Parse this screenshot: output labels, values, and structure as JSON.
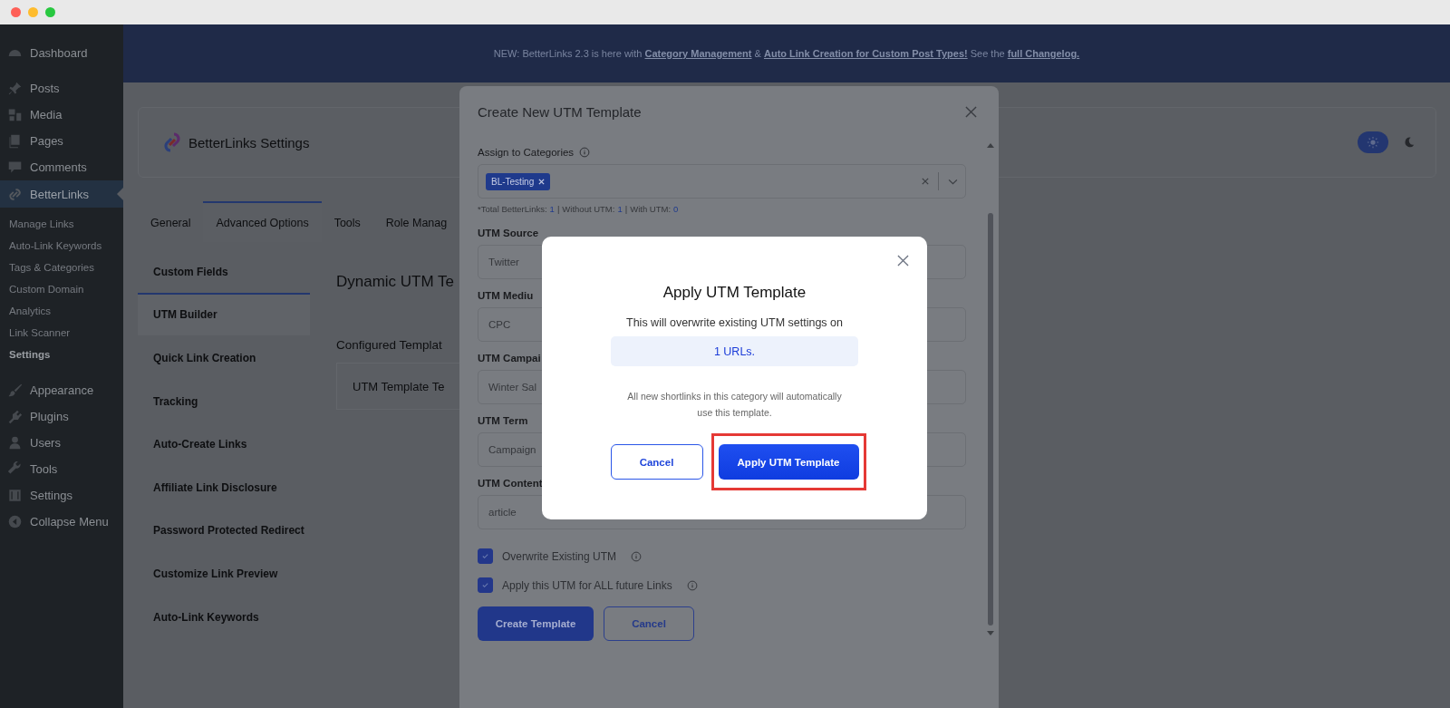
{
  "admin_menu": {
    "items": [
      {
        "label": "Dashboard",
        "selected": false
      },
      {
        "label": "Posts",
        "selected": false
      },
      {
        "label": "Media",
        "selected": false
      },
      {
        "label": "Pages",
        "selected": false
      },
      {
        "label": "Comments",
        "selected": false
      },
      {
        "label": "BetterLinks",
        "selected": true,
        "children": [
          {
            "label": "Manage Links",
            "selected": false
          },
          {
            "label": "Auto-Link Keywords",
            "selected": false
          },
          {
            "label": "Tags & Categories",
            "selected": false
          },
          {
            "label": "Custom Domain",
            "selected": false
          },
          {
            "label": "Analytics",
            "selected": false
          },
          {
            "label": "Link Scanner",
            "selected": false
          },
          {
            "label": "Settings",
            "selected": true
          }
        ]
      },
      {
        "label": "Appearance",
        "selected": false
      },
      {
        "label": "Plugins",
        "selected": false
      },
      {
        "label": "Users",
        "selected": false
      },
      {
        "label": "Tools",
        "selected": false
      },
      {
        "label": "Settings",
        "selected": false
      },
      {
        "label": "Collapse Menu",
        "selected": false
      }
    ]
  },
  "banner": {
    "parts": [
      {
        "text": "NEW: BetterLinks 2.3 is here with ",
        "link": false
      },
      {
        "text": "Category Management",
        "link": true
      },
      {
        "text": " & ",
        "link": false
      },
      {
        "text": "Auto Link Creation for Custom Post Types!",
        "link": true
      },
      {
        "text": " See the ",
        "link": false
      },
      {
        "text": "full Changelog.",
        "link": true
      }
    ]
  },
  "settings_header": {
    "title": "BetterLinks Settings",
    "theme_modes": [
      {
        "selected": true
      },
      {
        "selected": false
      }
    ]
  },
  "tabs": [
    {
      "label": "General",
      "selected": false
    },
    {
      "label": "Advanced Options",
      "selected": true
    },
    {
      "label": "Tools",
      "selected": false
    },
    {
      "label": "Role Manag",
      "selected": false
    }
  ],
  "settings_nav": [
    {
      "label": "Custom Fields",
      "selected": false
    },
    {
      "label": "UTM Builder",
      "selected": true
    },
    {
      "label": "Quick Link Creation",
      "selected": false
    },
    {
      "label": "Tracking",
      "selected": false
    },
    {
      "label": "Auto-Create Links",
      "selected": false
    },
    {
      "label": "Affiliate Link Disclosure",
      "selected": false
    },
    {
      "label": "Password Protected Redirect",
      "selected": false
    },
    {
      "label": "Customize Link Preview",
      "selected": false
    },
    {
      "label": "Auto-Link Keywords",
      "selected": false
    }
  ],
  "content": {
    "heading": "Dynamic UTM Te",
    "subheading": "Configured Templat",
    "template_card": "UTM Template Te"
  },
  "utm_dialog": {
    "title": "Create New UTM Template",
    "category_label": "Assign to Categories",
    "categories": [
      "BL-Testing"
    ],
    "stats": [
      {
        "label": "*Total BetterLinks:",
        "value": "1"
      },
      {
        "label": "Without UTM:",
        "value": "1"
      },
      {
        "label": "With UTM:",
        "value": "0"
      }
    ],
    "stats_separator": "|",
    "fields": [
      {
        "label": "UTM Source",
        "value": "Twitter"
      },
      {
        "label": "UTM Mediu",
        "value": "CPC"
      },
      {
        "label": "UTM Campai",
        "value": "Winter Sal"
      },
      {
        "label": "UTM Term",
        "value": "Campaign"
      },
      {
        "label": "UTM Content",
        "value": "article"
      }
    ],
    "options": [
      {
        "label": "Overwrite Existing UTM",
        "checked": true
      },
      {
        "label": "Apply this UTM for ALL future Links",
        "checked": true
      }
    ],
    "buttons": [
      {
        "label": "Create Template",
        "kind": "primary"
      },
      {
        "label": "Cancel",
        "kind": "secondary"
      }
    ]
  },
  "apply_dialog": {
    "title": "Apply UTM Template",
    "message": "This will overwrite existing UTM settings on",
    "count": "1 URLs.",
    "note": "All new shortlinks in this category will automatically use this template.",
    "buttons": [
      {
        "label": "Cancel",
        "kind": "secondary",
        "highlighted": false
      },
      {
        "label": "Apply UTM Template",
        "kind": "primary",
        "highlighted": true
      }
    ]
  }
}
